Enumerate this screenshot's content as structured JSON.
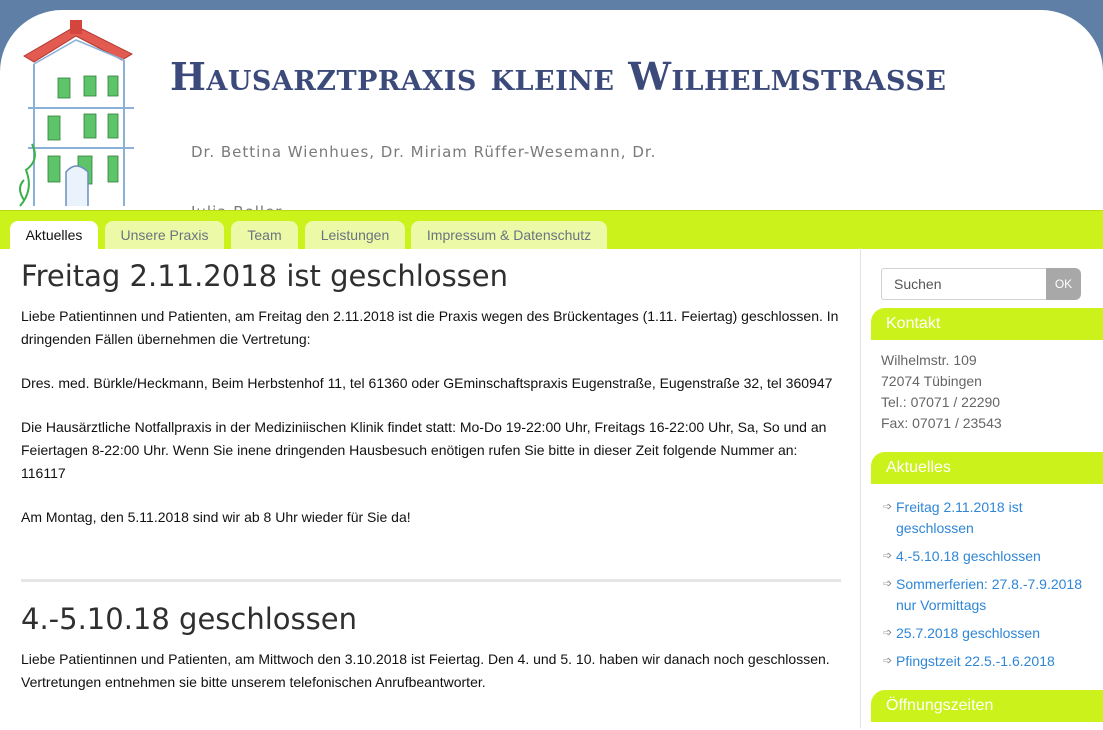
{
  "site": {
    "title": "Hausarztpraxis kleine Wilhelmstrasse",
    "description": "Dr. Bettina Wienhues, Dr. Miriam Rüffer-Wesemann, Dr. Julia Beller"
  },
  "nav": {
    "tabs": [
      {
        "label": "Aktuelles",
        "active": true
      },
      {
        "label": "Unsere Praxis",
        "active": false
      },
      {
        "label": "Team",
        "active": false
      },
      {
        "label": "Leistungen",
        "active": false
      },
      {
        "label": "Impressum & Datenschutz",
        "active": false
      }
    ]
  },
  "posts": [
    {
      "title": "Freitag 2.11.2018 ist geschlossen",
      "paragraphs": [
        "Liebe Patientinnen und Patienten, am Freitag den 2.11.2018 ist die Praxis wegen des Brückentages (1.11. Feiertag) geschlossen. In dringenden Fällen übernehmen die Vertretung:",
        "Dres. med. Bürkle/Heckmann, Beim Herbstenhof 11, tel 61360 oder GEminschaftspraxis Eugenstraße, Eugenstraße 32, tel 360947",
        "Die Hausärztliche Notfallpraxis in der Mediziniischen Klinik findet statt: Mo-Do 19-22:00 Uhr, Freitags 16-22:00 Uhr, Sa, So und an Feiertagen 8-22:00 Uhr. Wenn Sie inene dringenden Hausbesuch enötigen rufen Sie bitte in dieser Zeit folgende Nummer an: 116117",
        "Am Montag, den 5.11.2018 sind wir ab 8 Uhr wieder für Sie da!"
      ]
    },
    {
      "title": "4.-5.10.18 geschlossen",
      "paragraphs": [
        "Liebe Patientinnen und Patienten, am Mittwoch den 3.10.2018 ist Feiertag. Den 4. und 5. 10. haben wir danach noch geschlossen. Vertretungen entnehmen sie bitte unserem telefonischen Anrufbeantworter."
      ]
    }
  ],
  "sidebar": {
    "search": {
      "placeholder": "Suchen",
      "button_label": "OK"
    },
    "contact": {
      "title": "Kontakt",
      "lines": [
        "Wilhelmstr. 109",
        "72074 Tübingen",
        "Tel.: 07071 / 22290",
        "Fax: 07071 / 23543"
      ]
    },
    "news": {
      "title": "Aktuelles",
      "items": [
        "Freitag 2.11.2018 ist geschlossen",
        "4.-5.10.18 geschlossen",
        "Sommerferien: 27.8.-7.9.2018 nur Vormittags",
        "25.7.2018 geschlossen",
        "Pfingstzeit 22.5.-1.6.2018"
      ],
      "arrow_icon": "arrow-right-icon"
    },
    "hours": {
      "title": "Öffnungszeiten"
    }
  },
  "colors": {
    "nav_green": "#ccf21b",
    "title_blue": "#3b4a7a",
    "link_blue": "#2f86d6",
    "frame_blue": "#5f7fa6"
  }
}
